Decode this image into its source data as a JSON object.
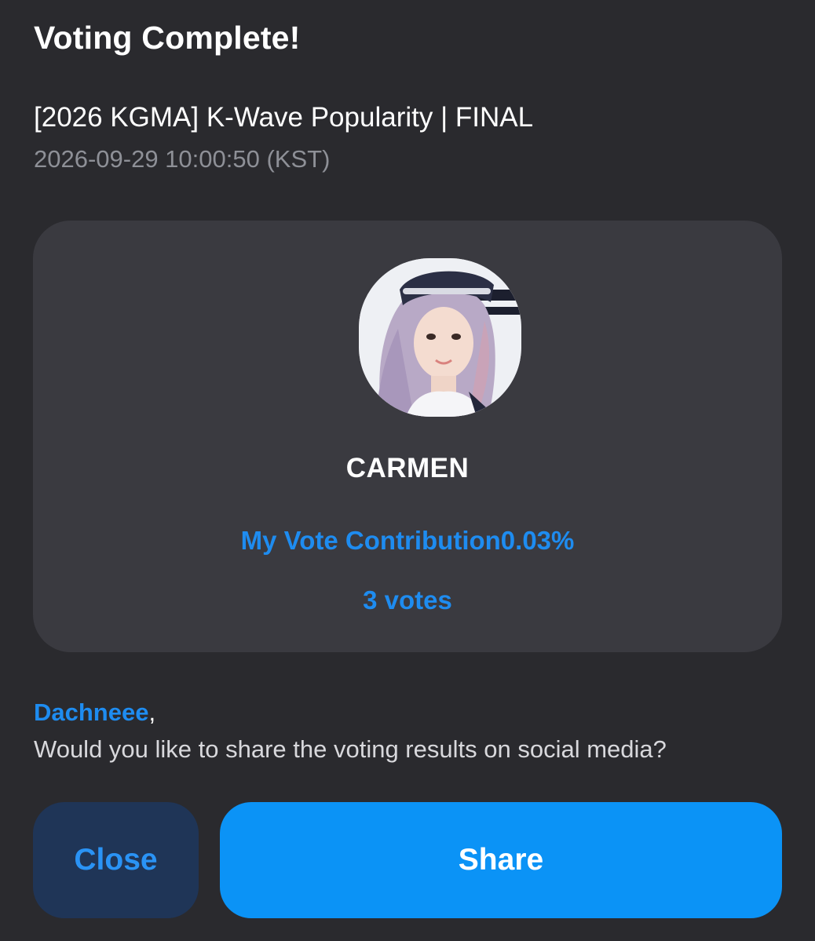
{
  "header": {
    "title": "Voting Complete!"
  },
  "event": {
    "name": "[2026 KGMA] K-Wave Popularity | FINAL",
    "timestamp": "2026-09-29 10:00:50 (KST)"
  },
  "card": {
    "avatar_icon": "artist-photo",
    "artist_name": "CARMEN",
    "contribution_text": "My Vote Contribution0.03%",
    "votes_text": "3 votes"
  },
  "share_prompt": {
    "username": "Dachneee",
    "separator": ",",
    "question": "Would you like to share the voting results on social media?"
  },
  "actions": {
    "close_label": "Close",
    "share_label": "Share"
  },
  "colors": {
    "background": "#2a2a2e",
    "card": "#3a3a40",
    "accent": "#1e8cf0",
    "close_button_bg": "#1f3557",
    "share_button_bg": "#0b93f6"
  }
}
